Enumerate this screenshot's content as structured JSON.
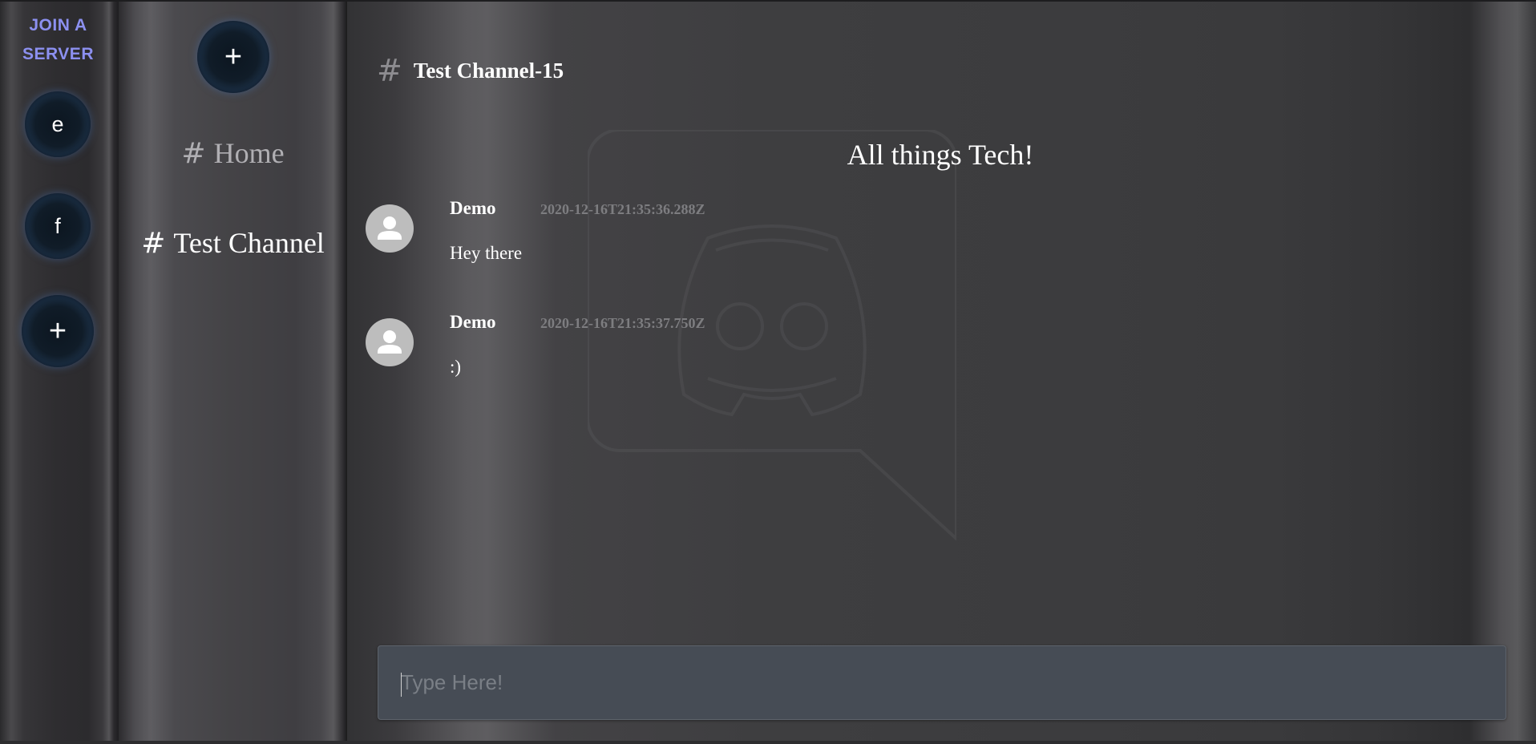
{
  "servers": {
    "join_label": "JOIN A SERVER",
    "items": [
      {
        "label": "e"
      },
      {
        "label": "f"
      }
    ],
    "add_label": "+"
  },
  "channels": {
    "add_label": "+",
    "hash": "#",
    "items": [
      {
        "label": "Home"
      },
      {
        "label": "Test Channel"
      }
    ]
  },
  "chat": {
    "channel_hash": "#",
    "channel_title": "Test Channel-15",
    "topic": "All things Tech!",
    "messages": [
      {
        "author": "Demo",
        "timestamp": "2020-12-16T21:35:36.288Z",
        "text": "Hey there"
      },
      {
        "author": "Demo",
        "timestamp": "2020-12-16T21:35:37.750Z",
        "text": ":)"
      }
    ],
    "composer_placeholder": "Type Here!"
  },
  "colors": {
    "accent": "#8c90f0",
    "orb_glow": "#3e5c86",
    "composer_bg": "#464c55",
    "avatar_bg": "#bdbdbd"
  }
}
